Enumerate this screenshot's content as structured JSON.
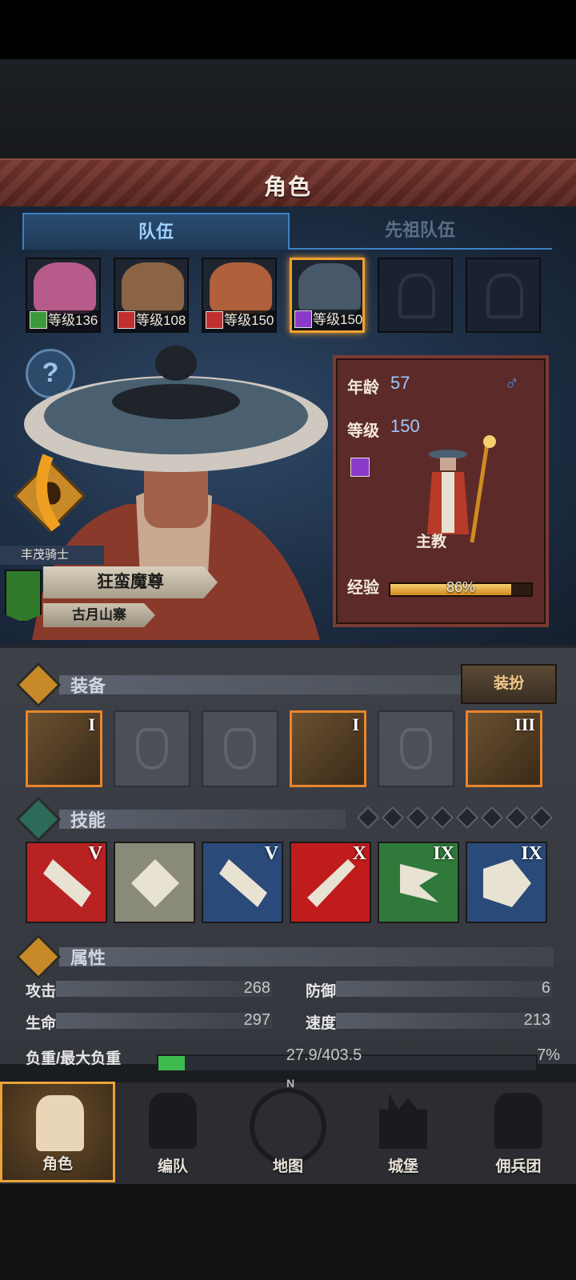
{
  "title": "角色",
  "tabs": [
    {
      "label": "队伍",
      "active": true
    },
    {
      "label": "先祖队伍",
      "active": false
    }
  ],
  "party": [
    {
      "level_text": "等级136",
      "class_color": "#3a9a3a",
      "face_color": "#b65b8a"
    },
    {
      "level_text": "等级108",
      "class_color": "#c23030",
      "face_color": "#8a6444"
    },
    {
      "level_text": "等级150",
      "class_color": "#c23030",
      "face_color": "#b0603a"
    },
    {
      "level_text": "等级150",
      "class_color": "#8a3ac8",
      "face_color": "#46586a",
      "selected": true
    }
  ],
  "character": {
    "age_label": "年龄",
    "age": "57",
    "gender_icon": "♂",
    "level_label": "等级",
    "level": "150",
    "class_name": "主教",
    "exp_label": "经验",
    "exp_percent": 86,
    "exp_text": "86%",
    "guild": "丰茂骑士",
    "name": "狂蛮魔尊",
    "origin": "古月山寨"
  },
  "equipment": {
    "section_label": "装备",
    "dress_button": "装扮",
    "slots": [
      {
        "filled": true,
        "rank": "I"
      },
      {
        "filled": false,
        "rank": ""
      },
      {
        "filled": false,
        "rank": ""
      },
      {
        "filled": true,
        "rank": "I"
      },
      {
        "filled": false,
        "rank": ""
      },
      {
        "filled": true,
        "rank": "III"
      }
    ]
  },
  "skills": {
    "section_label": "技能",
    "pip_count": 8,
    "items": [
      {
        "rank": "V",
        "color": "#b82222"
      },
      {
        "rank": "",
        "color": "#8a8a7a"
      },
      {
        "rank": "V",
        "color": "#2a4a7a"
      },
      {
        "rank": "X",
        "color": "#c01c1c"
      },
      {
        "rank": "IX",
        "color": "#2f7a3a"
      },
      {
        "rank": "IX",
        "color": "#2a4a7a"
      }
    ]
  },
  "attributes": {
    "section_label": "属性",
    "attack_label": "攻击",
    "attack": "268",
    "defense_label": "防御",
    "defense": "6",
    "hp_label": "生命",
    "hp": "297",
    "speed_label": "速度",
    "speed": "213",
    "load_label": "负重/最大负重",
    "load": "27.9/403.5",
    "load_percent_text": "7%",
    "load_percent": 7
  },
  "nav": [
    {
      "label": "角色",
      "active": true
    },
    {
      "label": "编队",
      "active": false
    },
    {
      "label": "地图",
      "active": false
    },
    {
      "label": "城堡",
      "active": false
    },
    {
      "label": "佣兵团",
      "active": false
    }
  ],
  "compass_n": "N"
}
